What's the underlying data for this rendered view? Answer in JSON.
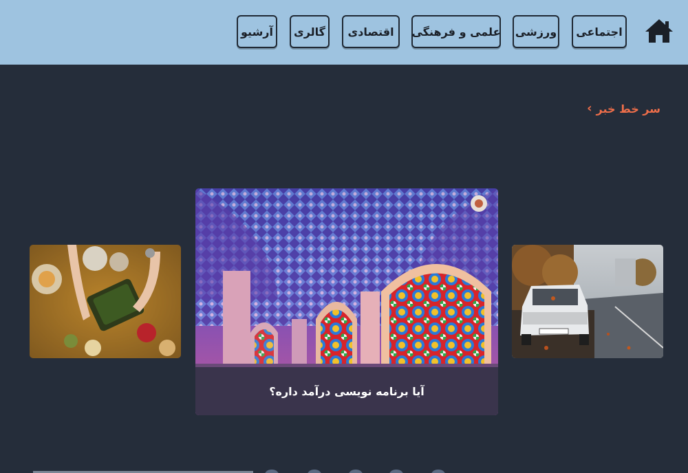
{
  "nav": {
    "home_icon": "home-icon",
    "items": [
      {
        "label": "اجتماعی"
      },
      {
        "label": "ورزشی"
      },
      {
        "label": "علمی و فرهنگی"
      },
      {
        "label": "اقتصادی"
      },
      {
        "label": "گالری"
      },
      {
        "label": "آرشیو"
      }
    ]
  },
  "section": {
    "title": "سر خط خبر",
    "chevron_icon": "chevron-right-icon",
    "accent": "#ee6e4a"
  },
  "slides": [
    {
      "image": "food-table-photo"
    },
    {
      "image": "mosque-stained-glass-photo",
      "caption": "آیا برنامه نویسی درآمد داره؟"
    },
    {
      "image": "white-car-street-photo"
    }
  ],
  "colors": {
    "header_bg": "#9ec3e0",
    "page_bg": "#252d3a",
    "nav_border": "#1f2833"
  }
}
